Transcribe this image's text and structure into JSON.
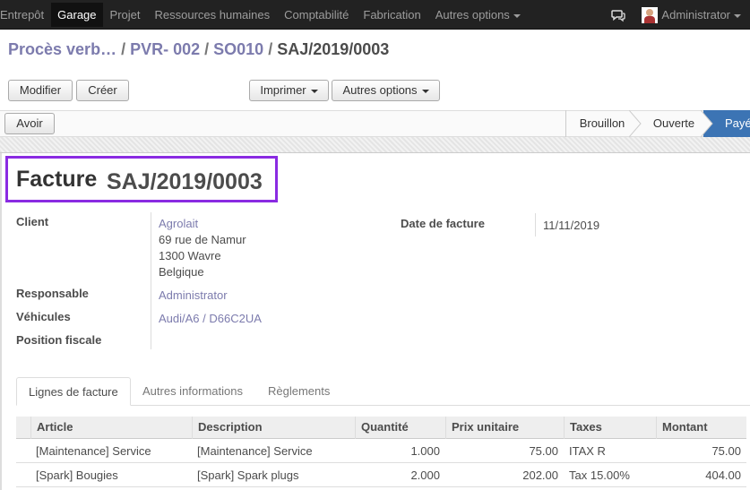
{
  "topbar": {
    "menu": [
      "Entrepôt",
      "Garage",
      "Projet",
      "Ressources humaines",
      "Comptabilité",
      "Fabrication",
      "Autres options"
    ],
    "active": "Garage",
    "user": "Administrator"
  },
  "breadcrumb": {
    "items": [
      "Procès verb…",
      "PVR- 002",
      "SO010"
    ],
    "current": "SAJ/2019/0003"
  },
  "buttons": {
    "edit": "Modifier",
    "create": "Créer",
    "print": "Imprimer",
    "more": "Autres options",
    "refund": "Avoir"
  },
  "statusbar": {
    "stages": [
      "Brouillon",
      "Ouverte",
      "Payé"
    ],
    "active": "Payé",
    "active_color": "#3c74b4"
  },
  "invoice": {
    "title_label": "Facture",
    "number": "SAJ/2019/0003",
    "client_label": "Client",
    "client_name": "Agrolait",
    "client_address": [
      "69 rue de Namur",
      "1300 Wavre",
      "Belgique"
    ],
    "responsible_label": "Responsable",
    "responsible": "Administrator",
    "vehicles_label": "Véhicules",
    "vehicles": "Audi/A6 / D66C2UA",
    "fiscal_label": "Position fiscale",
    "fiscal": "",
    "date_label": "Date de facture",
    "date": "11/11/2019"
  },
  "tabs": [
    "Lignes de facture",
    "Autres informations",
    "Règlements"
  ],
  "lines": {
    "columns": [
      "Article",
      "Description",
      "Quantité",
      "Prix unitaire",
      "Taxes",
      "Montant"
    ],
    "rows": [
      [
        "[Maintenance] Service",
        "[Maintenance] Service",
        "1.000",
        "75.00",
        "ITAX R",
        "75.00"
      ],
      [
        "[Spark] Bougies",
        "[Spark] Spark plugs",
        "2.000",
        "202.00",
        "Tax 15.00%",
        "404.00"
      ]
    ]
  },
  "colors": {
    "highlight_box": "#8a2be2",
    "link": "#7c7bad",
    "navbar": "#222222"
  }
}
